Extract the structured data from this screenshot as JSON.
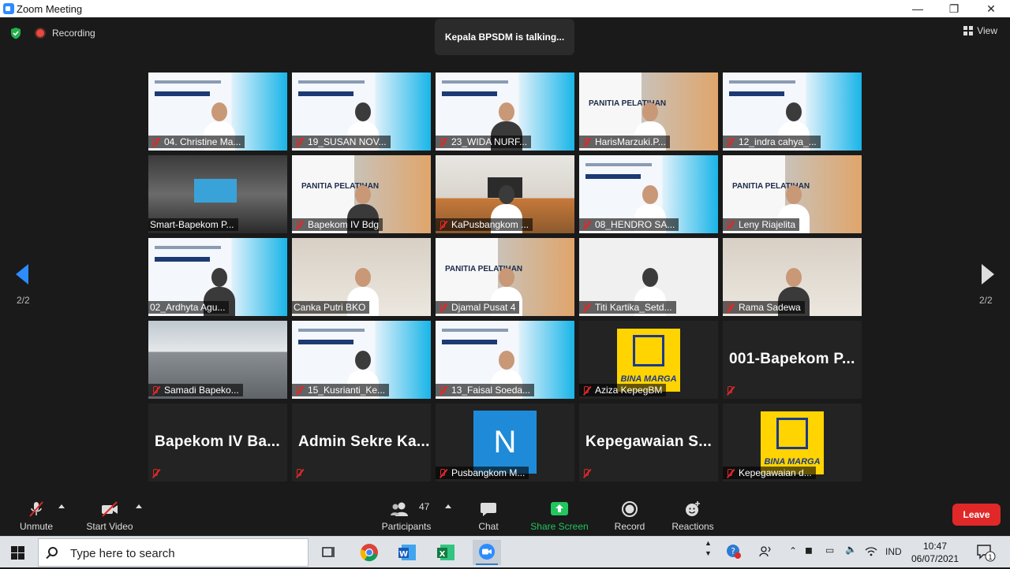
{
  "window": {
    "title": "Zoom Meeting",
    "minimize_icon": "minimize-icon",
    "maximize_icon": "restore-icon",
    "close_icon": "close-icon"
  },
  "meeting_top": {
    "recording_label": "Recording",
    "talking_banner": "Kepala BPSDM is talking...",
    "view_label": "View",
    "page_indicator_left": "2/2",
    "page_indicator_right": "2/2"
  },
  "participants_grid": [
    {
      "name": "04. Christine Ma...",
      "muted": true,
      "video": "slide-pka"
    },
    {
      "name": "19_SUSAN NOV...",
      "muted": true,
      "video": "slide-pka"
    },
    {
      "name": "23_WIDA NURF...",
      "muted": true,
      "video": "slide-pka"
    },
    {
      "name": "HarisMarzuki.P...",
      "muted": true,
      "video": "panitia"
    },
    {
      "name": "12_indra cahya_...",
      "muted": true,
      "video": "slide-pka"
    },
    {
      "name": "Smart-Bapekom P...",
      "muted": false,
      "video": "room"
    },
    {
      "name": "Bapekom IV Bdg",
      "muted": true,
      "video": "panitia"
    },
    {
      "name": "KaPusbangkom ...",
      "muted": true,
      "video": "office"
    },
    {
      "name": "08_HENDRO SA...",
      "muted": true,
      "video": "slide-pka"
    },
    {
      "name": "Leny Riajelita",
      "muted": true,
      "video": "panitia"
    },
    {
      "name": "02_Ardhyta Agu...",
      "muted": false,
      "video": "slide-pka"
    },
    {
      "name": "Canka Putri BKO",
      "muted": false,
      "video": "wall"
    },
    {
      "name": "Djamal Pusat 4",
      "muted": true,
      "video": "panitia"
    },
    {
      "name": "Titi Kartika_Setd...",
      "muted": true,
      "video": "plain"
    },
    {
      "name": "Rama Sadewa",
      "muted": true,
      "video": "wall"
    },
    {
      "name": "Samadi Bapeko...",
      "muted": true,
      "video": "building"
    },
    {
      "name": "15_Kusrianti_Ke...",
      "muted": true,
      "video": "slide-pka"
    },
    {
      "name": "13_Faisal Soeda...",
      "muted": true,
      "video": "slide-pka"
    },
    {
      "name": "Aziza KepegBM",
      "muted": true,
      "video": "logo-binamarga"
    },
    {
      "name": "",
      "muted": true,
      "video": "name-only",
      "display_name": "001-Bapekom  P..."
    },
    {
      "name": "",
      "muted": true,
      "video": "name-only",
      "display_name": "Bapekom  IV  Ba..."
    },
    {
      "name": "",
      "muted": true,
      "video": "name-only",
      "display_name": "Admin  Sekre  Ka..."
    },
    {
      "name": "Pusbangkom M...",
      "muted": true,
      "video": "avatar-n",
      "avatar_letter": "N"
    },
    {
      "name": "",
      "muted": true,
      "video": "name-only",
      "display_name": "Kepegawaian  S..."
    },
    {
      "name": "Kepegawaian d...",
      "muted": true,
      "video": "logo-binamarga"
    }
  ],
  "slide_texts": {
    "panitia": "PANITIA PELATIHAN",
    "binamarga": "BINA MARGA"
  },
  "controls": {
    "unmute": "Unmute",
    "start_video": "Start Video",
    "participants": "Participants",
    "participants_count": "47",
    "chat": "Chat",
    "share_screen": "Share Screen",
    "record": "Record",
    "reactions": "Reactions",
    "leave": "Leave"
  },
  "taskbar": {
    "search_placeholder": "Type here to search",
    "language": "IND",
    "time": "10:47",
    "date": "06/07/2021",
    "notification_count": "1"
  },
  "colors": {
    "accent_blue": "#2d8cff",
    "share_green": "#22c55e",
    "leave_red": "#e02828",
    "mute_red": "#e02828"
  }
}
